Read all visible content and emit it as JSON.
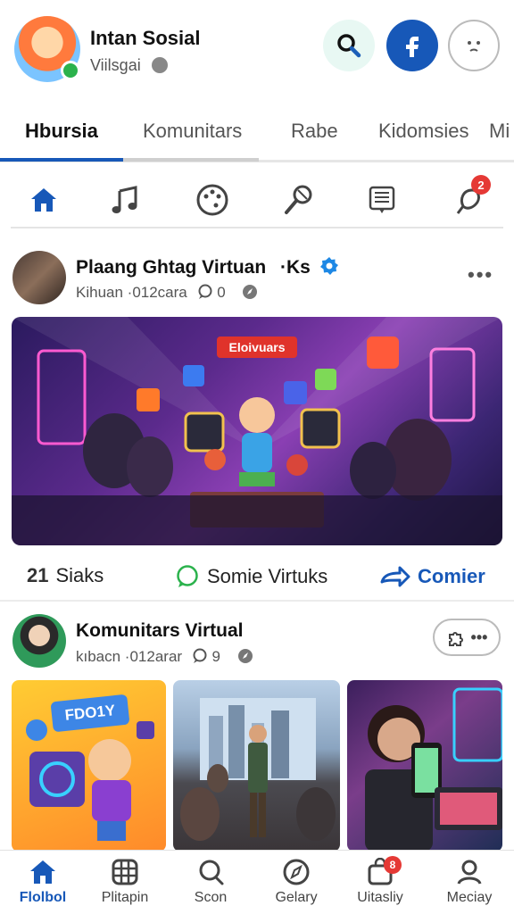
{
  "header": {
    "title": "Intan Sosial",
    "subtitle": "Viilsgai"
  },
  "tabs": [
    {
      "label": "Hbursia",
      "active": true
    },
    {
      "label": "Komunitars"
    },
    {
      "label": "Rabe"
    },
    {
      "label": "Kidomsies"
    },
    {
      "label": "Mi"
    }
  ],
  "icon_row": {
    "items": [
      "home-icon",
      "music-note-icon",
      "palette-icon",
      "microphone-icon",
      "news-icon",
      "notification-icon"
    ],
    "notification_count": "2"
  },
  "post1": {
    "title": "Plaang Ghtag Virtuan",
    "title_suffix": "·Ks",
    "meta": "Kihuan ·012cara",
    "comment_count": "0",
    "image_banner": "Eloivuars",
    "stats": {
      "count": "21",
      "likes_label": "Siaks",
      "comment_label": "Somie Virtuks",
      "share_label": "Comier"
    }
  },
  "post2": {
    "title": "Komunitars Virtual",
    "meta": "kıbacn ·012arar",
    "comment_count": "9",
    "more_label": "•••",
    "thumb1_label": "FDO1Y"
  },
  "bottom_nav": [
    {
      "label": "Flolbol",
      "icon": "home-icon",
      "active": true
    },
    {
      "label": "Plitapin",
      "icon": "grid-icon"
    },
    {
      "label": "Scon",
      "icon": "search-icon"
    },
    {
      "label": "Gelary",
      "icon": "compass-icon"
    },
    {
      "label": "Uitasliy",
      "icon": "bag-icon",
      "badge": "8"
    },
    {
      "label": "Meciay",
      "icon": "profile-icon"
    }
  ],
  "colors": {
    "brand": "#1758b8",
    "accent_green": "#2bb24c",
    "badge_red": "#e53935"
  }
}
